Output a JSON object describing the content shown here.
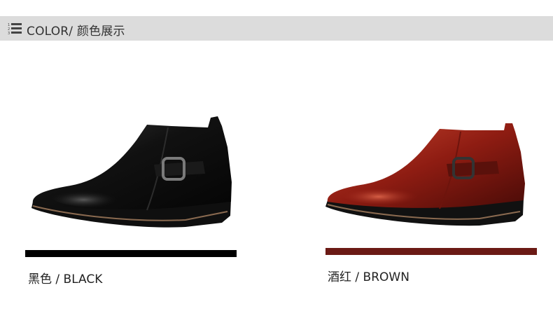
{
  "header": {
    "title": "COLOR/ 颜色展示",
    "icon": "numbered-list-icon",
    "background": "#dcdcdc"
  },
  "products": [
    {
      "name": "black-boot",
      "label": "黑色 / BLACK",
      "swatch": "#000000"
    },
    {
      "name": "brown-boot",
      "label": "酒红 / BROWN",
      "swatch": "#6b1a15"
    }
  ]
}
